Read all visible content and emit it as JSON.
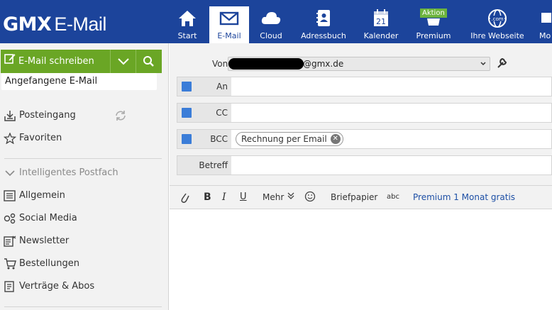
{
  "brand": {
    "logo": "GMX",
    "product": "E-Mail"
  },
  "nav": {
    "items": [
      {
        "label": "Start",
        "icon": "home-icon"
      },
      {
        "label": "E-Mail",
        "icon": "envelope-icon",
        "active": true
      },
      {
        "label": "Cloud",
        "icon": "cloud-icon"
      },
      {
        "label": "Adressbuch",
        "icon": "address-book-icon"
      },
      {
        "label": "Kalender",
        "icon": "calendar-icon",
        "icon_text": "21"
      },
      {
        "label": "Premium",
        "icon": "crown-icon",
        "badge": "Aktion"
      },
      {
        "label": "Ihre Webseite",
        "icon": "globe-icon",
        "icon_text": ".com"
      },
      {
        "label": "Mo",
        "icon": "more-icon"
      }
    ]
  },
  "sidebar": {
    "compose_label": "E-Mail schreiben",
    "draft_label": "Angefangene E-Mail",
    "items": [
      {
        "label": "Posteingang",
        "icon": "inbox-icon"
      },
      {
        "label": "Favoriten",
        "icon": "star-icon"
      },
      {
        "label": "Intelligentes Postfach",
        "icon": "chevron-down-icon"
      },
      {
        "label": "Allgemein",
        "icon": "list-icon"
      },
      {
        "label": "Social Media",
        "icon": "social-icon"
      },
      {
        "label": "Newsletter",
        "icon": "newsletter-icon"
      },
      {
        "label": "Bestellungen",
        "icon": "cart-icon"
      },
      {
        "label": "Verträge & Abos",
        "icon": "contract-icon"
      }
    ]
  },
  "compose": {
    "from_label": "Von",
    "from_domain": "@gmx.de",
    "to_label": "An",
    "cc_label": "CC",
    "bcc_label": "BCC",
    "bcc_chip": "Rechnung per Email",
    "subject_label": "Betreff"
  },
  "toolbar": {
    "bold": "B",
    "italic": "I",
    "underline": "U",
    "more": "Mehr",
    "stationery": "Briefpapier",
    "spellcheck": "abc",
    "premium_link": "Premium 1 Monat gratis"
  },
  "colors": {
    "brand_blue": "#1c449b",
    "compose_green": "#6aa625",
    "badge_green": "#6cb33e",
    "link_blue": "#1d4fa5"
  }
}
